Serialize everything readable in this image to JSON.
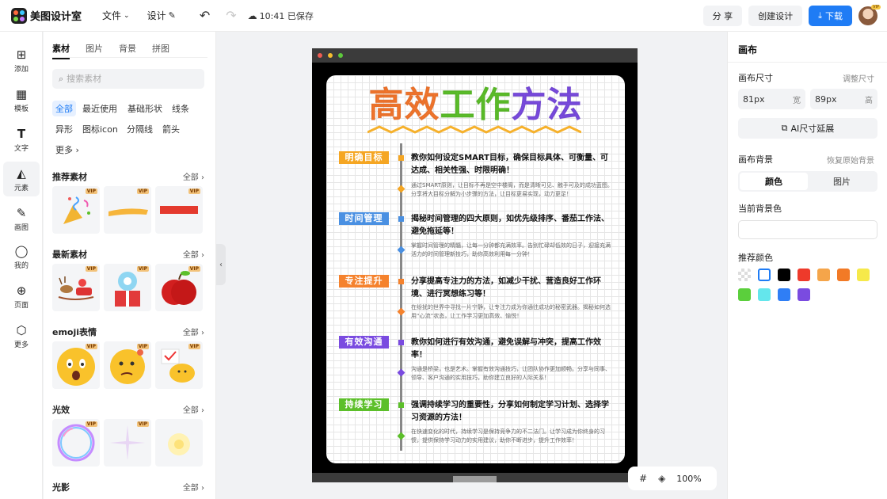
{
  "app": {
    "name": "美图设计室"
  },
  "topbar": {
    "file_label": "文件",
    "design_label": "设计",
    "saved_text": "10:41 已保存",
    "share_label": "分 享",
    "create_label": "创建设计",
    "download_label": "下载",
    "avatar_badge": "VIP"
  },
  "rail": {
    "items": [
      {
        "label": "添加",
        "icon": "plus-square-icon"
      },
      {
        "label": "模板",
        "icon": "template-icon"
      },
      {
        "label": "文字",
        "icon": "text-icon"
      },
      {
        "label": "元素",
        "icon": "shapes-icon"
      },
      {
        "label": "画图",
        "icon": "draw-icon"
      },
      {
        "label": "我的",
        "icon": "user-icon"
      },
      {
        "label": "页面",
        "icon": "page-add-icon"
      },
      {
        "label": "更多",
        "icon": "cube-icon"
      }
    ]
  },
  "panel": {
    "tabs": [
      "素材",
      "图片",
      "背景",
      "拼图"
    ],
    "search_placeholder": "搜索素材",
    "chips": [
      "全部",
      "最近使用",
      "基础形状",
      "线条",
      "异形",
      "图标icon",
      "分隔线",
      "箭头",
      "更多"
    ],
    "sections": [
      {
        "title": "推荐素材",
        "all": "全部"
      },
      {
        "title": "最新素材",
        "all": "全部"
      },
      {
        "title": "emoji表情",
        "all": "全部"
      },
      {
        "title": "光效",
        "all": "全部"
      },
      {
        "title": "光影",
        "all": "全部"
      }
    ],
    "vip": "VIP"
  },
  "poster": {
    "title_parts": [
      "高效",
      "工作",
      "方法"
    ],
    "title_colors": [
      "#f5772d",
      "#5cbf2a",
      "#7a4be0"
    ],
    "steps": [
      {
        "label": "明确目标",
        "color": "#f5a623",
        "head": "教你如何设定SMART目标，确保目标具体、可衡量、可达成、相关性强、时限明确！",
        "body": "通过SMART原则，让目标不再是空中楼阁，而是清晰可见、触手可及的成功蓝图。分享将大目标分解为小步骤的方法，让目标更易实现，动力更足！"
      },
      {
        "label": "时间管理",
        "color": "#4a90e2",
        "head": "揭秘时间管理的四大原则，如优先级排序、番茄工作法、避免拖延等！",
        "body": "掌握时间管理的精髓，让每一分钟都充满效率。告别忙碌却低效的日子，迎接充满活力的时间管理新技巧，助你高效利用每一分钟！"
      },
      {
        "label": "专注提升",
        "color": "#f5822d",
        "head": "分享提高专注力的方法，如减少干扰、营造良好工作环境、进行冥想练习等！",
        "body": "在纷扰的世界中寻找一片宁静，让专注力成为你通往成功的秘密武器。揭秘如何选用“心流”状态，让工作学习更加高效、愉悦！"
      },
      {
        "label": "有效沟通",
        "color": "#7a4be0",
        "head": "教你如何进行有效沟通，避免误解与冲突，提高工作效率！",
        "body": "沟通是桥梁，也是艺术。掌握有效沟通技巧，让团队协作更加顺畅。分享与同事、领导、客户沟通的实用技巧，助你建立良好的人际关系！"
      },
      {
        "label": "持续学习",
        "color": "#5cbf2a",
        "head": "强调持续学习的重要性，分享如何制定学习计划、选择学习资源的方法！",
        "body": "在快速变化的时代，持续学习是保持竞争力的不二法门。让学习成为你终身的习惯，提供保持学习动力的实用建议，助你不断进步，提升工作效率！"
      }
    ]
  },
  "floatbar": {
    "zoom": "100%"
  },
  "props": {
    "title": "画布",
    "size_label": "画布尺寸",
    "size_link": "调整尺寸",
    "width_value": "81px",
    "width_unit": "宽",
    "height_value": "89px",
    "height_unit": "高",
    "ai_button": "AI尺寸延展",
    "bg_label": "画布背景",
    "bg_reset": "恢复原始背景",
    "seg_color": "颜色",
    "seg_image": "图片",
    "current_bg": "当前背景色",
    "rec_colors_label": "推荐颜色",
    "rec_colors": [
      "transparent",
      "#ffffff",
      "#000000",
      "#ee3a2b",
      "#f5a54a",
      "#f27a26",
      "#f6e94a",
      "#5bcf3c",
      "#64e6ec",
      "#2f7ef5",
      "#7a4be0"
    ]
  }
}
